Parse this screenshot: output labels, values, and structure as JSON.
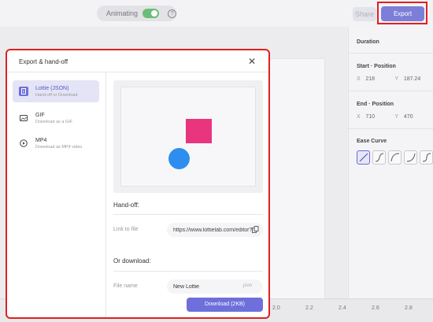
{
  "topbar": {
    "animating_label": "Animating",
    "share_label": "Share",
    "export_label": "Export"
  },
  "properties": {
    "duration_label": "Duration",
    "start_position_label": "Start · Position",
    "start_x": "218",
    "start_y": "187.24",
    "end_position_label": "End · Position",
    "end_x": "710",
    "end_y": "470",
    "axis_x": "X",
    "axis_y": "Y",
    "ease_curve_label": "Ease Curve"
  },
  "timeline": {
    "ticks": [
      "2.0",
      "2.2",
      "2.4",
      "2.6",
      "2.8"
    ]
  },
  "modal": {
    "title": "Export & hand-off",
    "formats": [
      {
        "label": "Lottie (JSON)",
        "sub": "Hand-off or Download",
        "icon": "json-file-icon"
      },
      {
        "label": "GIF",
        "sub": "Download as a GIF",
        "icon": "image-icon"
      },
      {
        "label": "MP4",
        "sub": "Download as MP4 video",
        "icon": "play-icon"
      }
    ],
    "handoff_label": "Hand-off:",
    "link_label": "Link to file",
    "link_value": "https://www.lottielab.com/editor?file...",
    "or_download_label": "Or download:",
    "filename_label": "File name",
    "filename_value": "New Lottie",
    "extension": ".json",
    "download_label": "Download (2KB)"
  },
  "colors": {
    "accent": "#6e6fdb",
    "shape_square": "#e8357e",
    "shape_circle": "#2d8ef0",
    "highlight": "#e02020"
  }
}
